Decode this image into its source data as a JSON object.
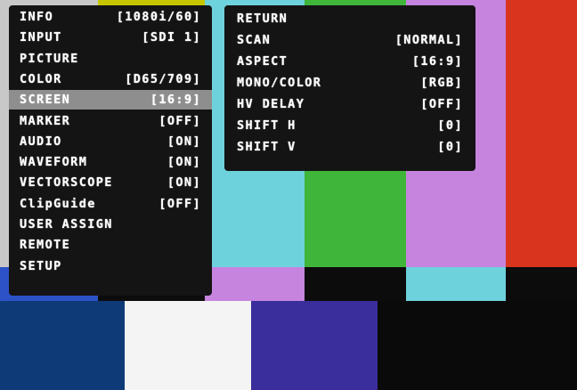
{
  "main_menu": {
    "items": [
      {
        "label": "INFO",
        "value": "[1080i/60]"
      },
      {
        "label": "INPUT",
        "value": "[SDI 1]"
      },
      {
        "label": "PICTURE",
        "value": ""
      },
      {
        "label": "COLOR",
        "value": "[D65/709]"
      },
      {
        "label": "SCREEN",
        "value": "[16:9]",
        "selected": true
      },
      {
        "label": "MARKER",
        "value": "[OFF]"
      },
      {
        "label": "AUDIO",
        "value": "[ON]"
      },
      {
        "label": "WAVEFORM",
        "value": "[ON]"
      },
      {
        "label": "VECTORSCOPE",
        "value": "[ON]"
      },
      {
        "label": "ClipGuide",
        "value": "[OFF]"
      },
      {
        "label": "USER ASSIGN",
        "value": ""
      },
      {
        "label": "REMOTE",
        "value": ""
      },
      {
        "label": "SETUP",
        "value": ""
      }
    ]
  },
  "screen_submenu": {
    "items": [
      {
        "label": "RETURN",
        "value": ""
      },
      {
        "label": "SCAN",
        "value": "[NORMAL]"
      },
      {
        "label": "ASPECT",
        "value": "[16:9]"
      },
      {
        "label": "MONO/COLOR",
        "value": "[RGB]"
      },
      {
        "label": "HV DELAY",
        "value": "[OFF]"
      },
      {
        "label": "SHIFT H",
        "value": "[0]"
      },
      {
        "label": "SHIFT V",
        "value": "[0]"
      }
    ]
  },
  "colors": {
    "menu_bg": "#141414",
    "selected_row": "#8e8e8e",
    "menu_text": "#ffffff",
    "bar_white": "#c8c8c8",
    "bar_yellow": "#c6c600",
    "bar_cyan": "#6ed2dc",
    "bar_green": "#3fb53a",
    "bar_magenta": "#c684df",
    "bar_red": "#d9341e",
    "bar_blue": "#2d52c8",
    "pluge_white": "#f4f4f4",
    "pluge_navy": "#0f3a78",
    "pluge_purple": "#3a2d9c"
  }
}
